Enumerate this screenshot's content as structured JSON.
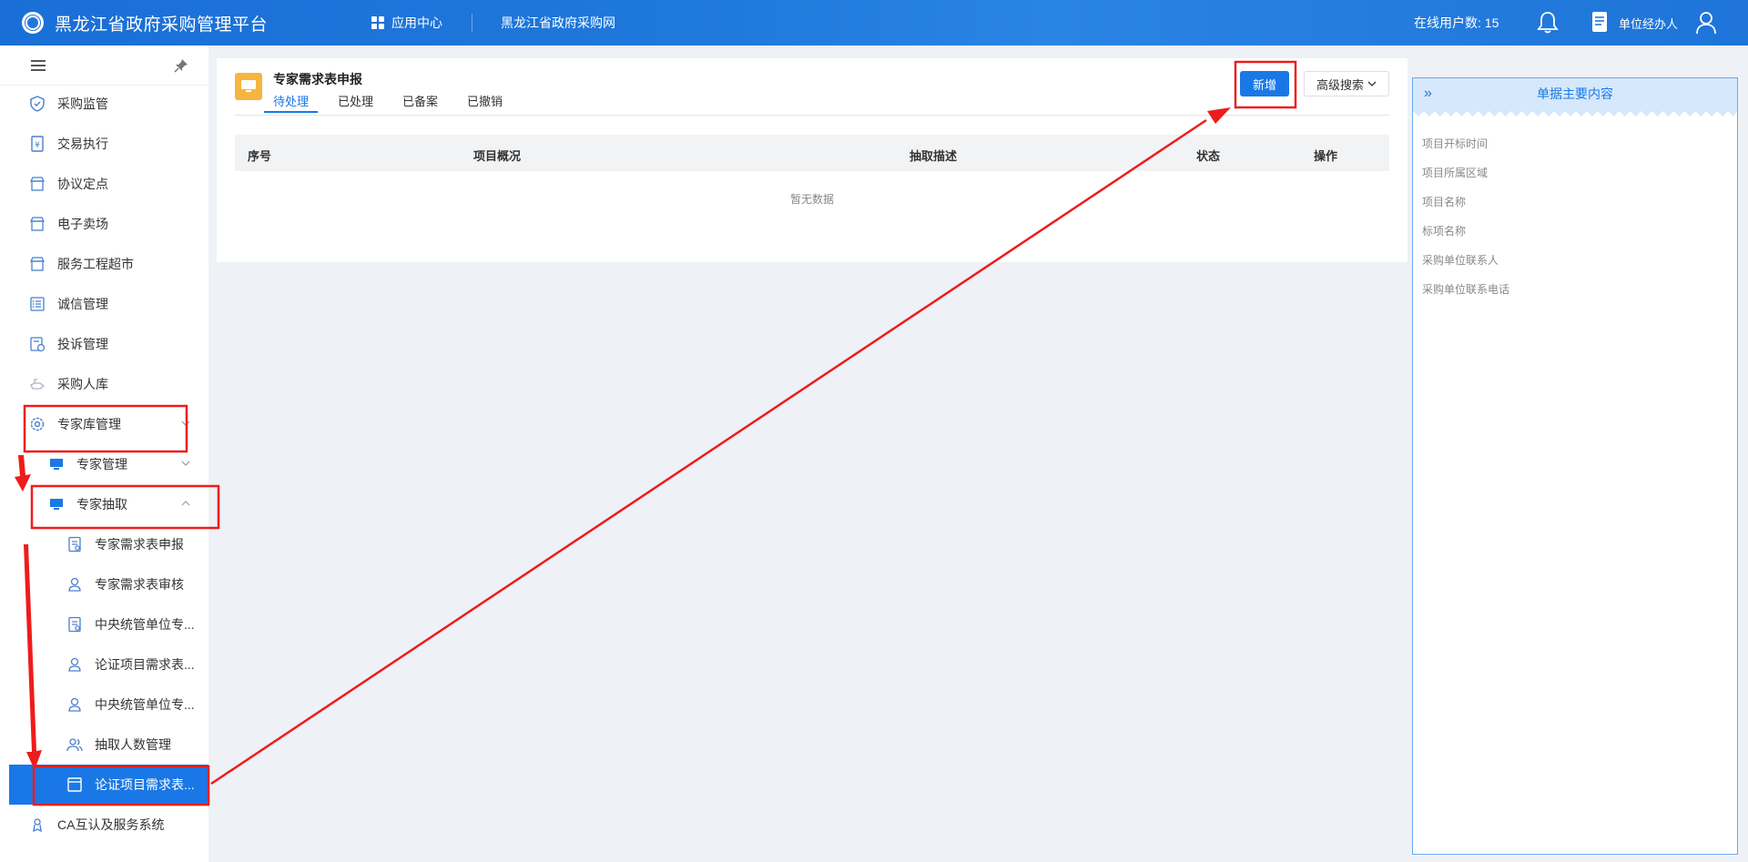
{
  "header": {
    "app_title": "黑龙江省政府采购管理平台",
    "nav_apps": "应用中心",
    "nav_site": "黑龙江省政府采购网",
    "online_label": "在线用户数: 15",
    "user_role": "单位经办人"
  },
  "sidebar": {
    "items": [
      {
        "label": "采购监管",
        "icon": "shield-icon"
      },
      {
        "label": "交易执行",
        "icon": "receipt-icon"
      },
      {
        "label": "协议定点",
        "icon": "store-icon"
      },
      {
        "label": "电子卖场",
        "icon": "store-icon"
      },
      {
        "label": "服务工程超市",
        "icon": "store-icon"
      },
      {
        "label": "诚信管理",
        "icon": "checklist-icon"
      },
      {
        "label": "投诉管理",
        "icon": "complaint-icon"
      },
      {
        "label": "采购人库",
        "icon": "hand-icon"
      },
      {
        "label": "专家库管理",
        "icon": "gear-icon"
      },
      {
        "label": "专家管理",
        "icon": "monitor-icon"
      },
      {
        "label": "专家抽取",
        "icon": "monitor-icon"
      },
      {
        "label": "专家需求表申报",
        "icon": "document-icon"
      },
      {
        "label": "专家需求表审核",
        "icon": "person-icon"
      },
      {
        "label": "中央统管单位专...",
        "icon": "document-icon"
      },
      {
        "label": "论证项目需求表...",
        "icon": "person-icon"
      },
      {
        "label": "中央统管单位专...",
        "icon": "person-icon"
      },
      {
        "label": "抽取人数管理",
        "icon": "people-icon"
      },
      {
        "label": "论证项目需求表...",
        "icon": "window-icon"
      },
      {
        "label": "CA互认及服务系统",
        "icon": "badge-icon"
      }
    ]
  },
  "main": {
    "form_title": "专家需求表申报",
    "tabs": [
      "待处理",
      "已处理",
      "已备案",
      "已撤销"
    ],
    "add_button": "新增",
    "adv_search": "高级搜索",
    "columns": [
      "序号",
      "项目概况",
      "抽取描述",
      "状态",
      "操作"
    ],
    "empty_text": "暂无数据"
  },
  "right_panel": {
    "title": "单据主要内容",
    "fields": [
      "项目开标时间",
      "项目所属区域",
      "项目名称",
      "标项名称",
      "采购单位联系人",
      "采购单位联系电话"
    ]
  },
  "colors": {
    "primary": "#1a78e6",
    "header_bg": "#1f78dc",
    "annotation": "#ee1c1c",
    "form_icon": "#f4b63f"
  }
}
